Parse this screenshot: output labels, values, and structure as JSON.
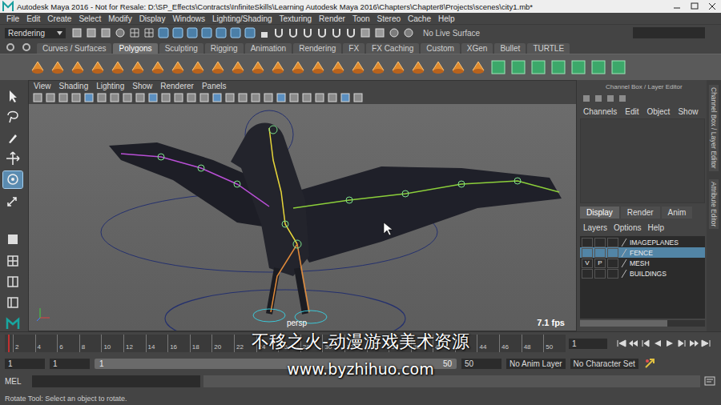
{
  "window": {
    "title": "Autodesk Maya 2016 - Not for Resale: D:\\SP_Effects\\Contracts\\InfiniteSkills\\Learning Autodesk Maya 2016\\Chapters\\Chapter8\\Projects\\scenes\\city1.mb*"
  },
  "menu": [
    "File",
    "Edit",
    "Create",
    "Select",
    "Modify",
    "Display",
    "Windows",
    "Lighting/Shading",
    "Texturing",
    "Render",
    "Toon",
    "Stereo",
    "Cache",
    "Help"
  ],
  "status_line": {
    "mode": "Rendering",
    "live_surface": "No Live Surface"
  },
  "shelf": {
    "tabs": [
      {
        "label": "Curves / Surfaces",
        "selected": false
      },
      {
        "label": "Polygons",
        "selected": true
      },
      {
        "label": "Sculpting",
        "selected": false
      },
      {
        "label": "Rigging",
        "selected": false
      },
      {
        "label": "Animation",
        "selected": false
      },
      {
        "label": "Rendering",
        "selected": false
      },
      {
        "label": "FX",
        "selected": false
      },
      {
        "label": "FX Caching",
        "selected": false
      },
      {
        "label": "Custom",
        "selected": false
      },
      {
        "label": "XGen",
        "selected": false
      },
      {
        "label": "Bullet",
        "selected": false
      },
      {
        "label": "TURTLE",
        "selected": false
      }
    ]
  },
  "toolbox": [
    {
      "tool": "select",
      "selected": false
    },
    {
      "tool": "lasso",
      "selected": false
    },
    {
      "tool": "paint",
      "selected": false
    },
    {
      "tool": "move",
      "selected": false
    },
    {
      "tool": "rotate",
      "selected": true
    },
    {
      "tool": "scale",
      "selected": false
    }
  ],
  "viewport": {
    "menu": [
      "View",
      "Shading",
      "Lighting",
      "Show",
      "Renderer",
      "Panels"
    ],
    "camera": "persp",
    "fps": "7.1 fps"
  },
  "channel_box": {
    "title": "Channel Box / Layer Editor",
    "menu": [
      "Channels",
      "Edit",
      "Object",
      "Show"
    ]
  },
  "layer_editor": {
    "tabs": [
      {
        "label": "Display",
        "selected": true
      },
      {
        "label": "Render",
        "selected": false
      },
      {
        "label": "Anim",
        "selected": false
      }
    ],
    "menu": [
      "Layers",
      "Options",
      "Help"
    ],
    "layers": [
      {
        "name": "IMAGEPLANES",
        "flags": [],
        "selected": false
      },
      {
        "name": "FENCE",
        "flags": [],
        "selected": true
      },
      {
        "name": "MESH",
        "flags": [
          "V",
          "P"
        ],
        "selected": false
      },
      {
        "name": "BUILDINGS",
        "flags": [],
        "selected": false
      }
    ]
  },
  "side_tabs": [
    "Channel Box / Layer Editor",
    "Attribute Editor"
  ],
  "timeline": {
    "ticks": [
      "2",
      "4",
      "6",
      "8",
      "10",
      "12",
      "14",
      "16",
      "18",
      "20",
      "22",
      "24",
      "26",
      "28",
      "30",
      "32",
      "34",
      "36",
      "38",
      "40",
      "42",
      "44",
      "46",
      "48",
      "50"
    ],
    "current": "1"
  },
  "range": {
    "start": "1",
    "inner_start": "1",
    "slider_start": "1",
    "slider_end": "50",
    "inner_end": "50",
    "anim_layer": "No Anim Layer",
    "character_set": "No Character Set"
  },
  "command_line": {
    "label": "MEL"
  },
  "help_line": "Rotate Tool: Select an object to rotate.",
  "watermark": [
    "不移之火-动漫游戏美术资源",
    "www.byzhihuo.com"
  ]
}
